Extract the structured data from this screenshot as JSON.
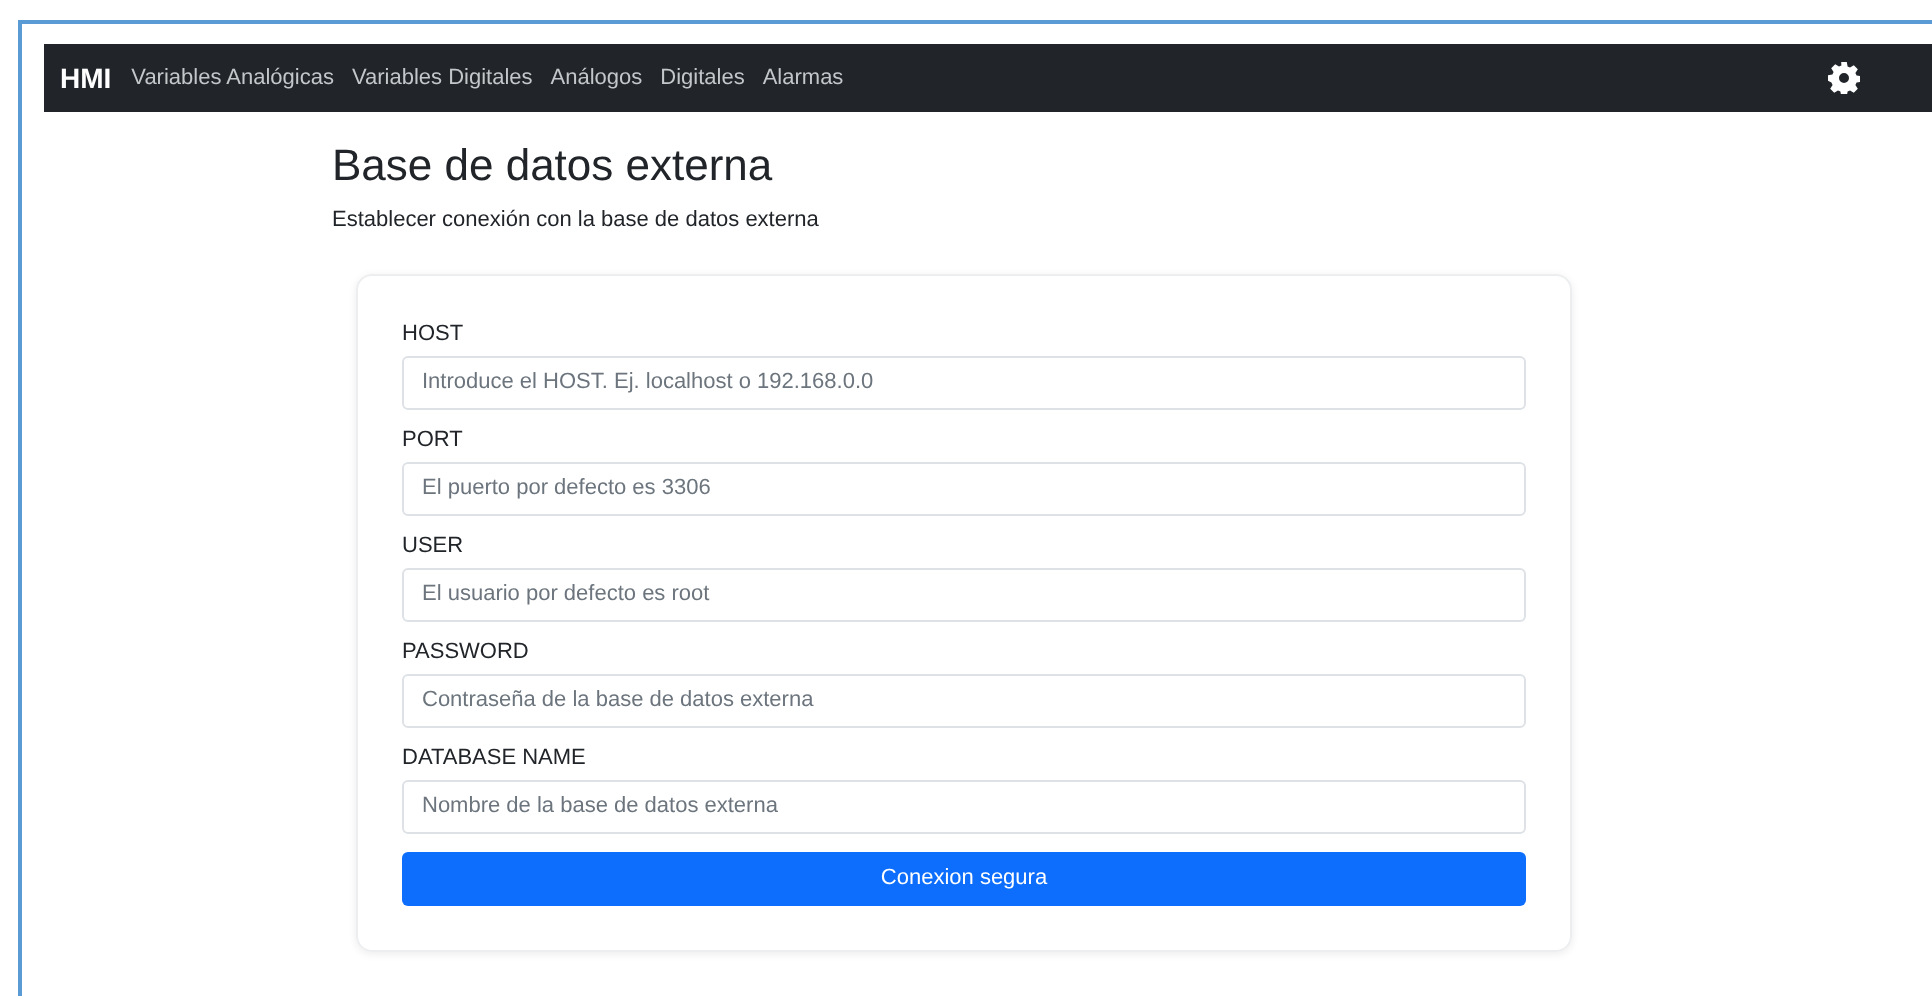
{
  "navbar": {
    "brand": "HMI",
    "links": [
      "Variables Analógicas",
      "Variables Digitales",
      "Análogos",
      "Digitales",
      "Alarmas"
    ]
  },
  "page": {
    "title": "Base de datos externa",
    "subtitle": "Establecer conexión con la base de datos externa"
  },
  "form": {
    "fields": [
      {
        "label": "HOST",
        "placeholder": "Introduce el HOST. Ej. localhost o 192.168.0.0"
      },
      {
        "label": "PORT",
        "placeholder": "El puerto por defecto es 3306"
      },
      {
        "label": "USER",
        "placeholder": "El usuario por defecto es root"
      },
      {
        "label": "PASSWORD",
        "placeholder": "Contraseña de la base de datos externa"
      },
      {
        "label": "DATABASE NAME",
        "placeholder": "Nombre de la base de datos externa"
      }
    ],
    "submit": "Conexion segura"
  }
}
